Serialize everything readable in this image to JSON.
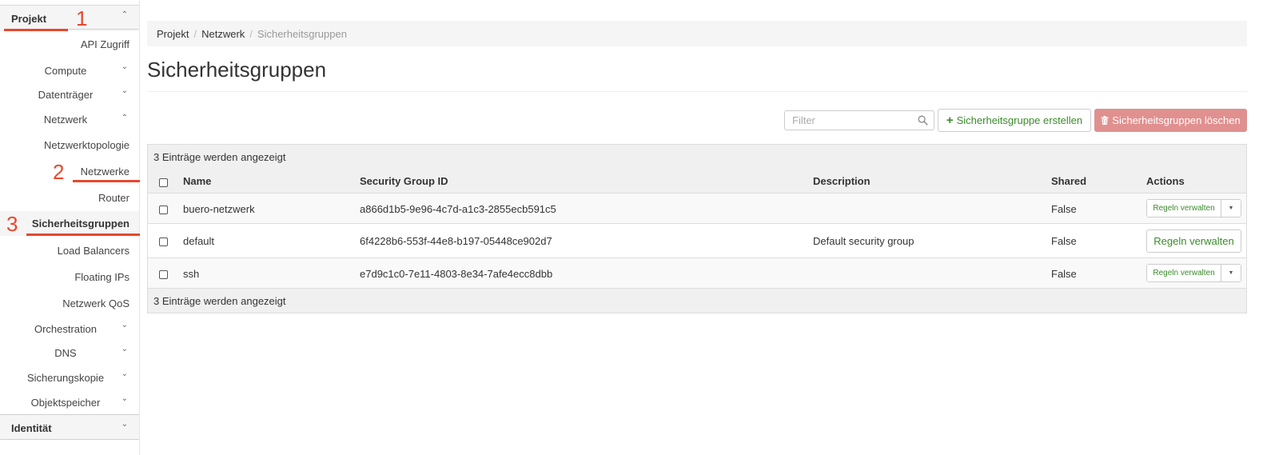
{
  "sidebar": {
    "project": {
      "label": "Projekt",
      "chevron": "chevron-up-icon"
    },
    "items": [
      {
        "label": "API Zugriff"
      },
      {
        "label": "Compute",
        "chevron": "chevron-down-icon"
      },
      {
        "label": "Datenträger",
        "chevron": "chevron-down-icon"
      },
      {
        "label": "Netzwerk",
        "chevron": "chevron-up-icon"
      },
      {
        "label": "Netzwerktopologie"
      },
      {
        "label": "Netzwerke"
      },
      {
        "label": "Router"
      },
      {
        "label": "Sicherheitsgruppen",
        "active": true
      },
      {
        "label": "Load Balancers"
      },
      {
        "label": "Floating IPs"
      },
      {
        "label": "Netzwerk QoS"
      },
      {
        "label": "Orchestration",
        "chevron": "chevron-down-icon"
      },
      {
        "label": "DNS",
        "chevron": "chevron-down-icon"
      },
      {
        "label": "Sicherungskopie",
        "chevron": "chevron-down-icon"
      },
      {
        "label": "Objektspeicher",
        "chevron": "chevron-down-icon"
      }
    ],
    "identity": {
      "label": "Identität",
      "chevron": "chevron-down-icon"
    }
  },
  "annotations": {
    "marker1": "1",
    "marker2": "2",
    "marker3": "3",
    "color": "#e8482d"
  },
  "breadcrumb": {
    "items": [
      "Projekt",
      "Netzwerk",
      "Sicherheitsgruppen"
    ],
    "separator": "/"
  },
  "page": {
    "title": "Sicherheitsgruppen"
  },
  "toolbar": {
    "filter_placeholder": "Filter",
    "create_label": "Sicherheitsgruppe erstellen",
    "delete_label": "Sicherheitsgruppen löschen"
  },
  "table": {
    "count_text_top": "3 Einträge werden angezeigt",
    "count_text_bottom": "3 Einträge werden angezeigt",
    "columns": [
      "Name",
      "Security Group ID",
      "Description",
      "Shared",
      "Actions"
    ],
    "rows": [
      {
        "name": "buero-netzwerk",
        "id": "a866d1b5-9e96-4c7d-a1c3-2855ecb591c5",
        "description": "",
        "shared": "False",
        "action": "Regeln verwalten"
      },
      {
        "name": "default",
        "id": "6f4228b6-553f-44e8-b197-05448ce902d7",
        "description": "Default security group",
        "shared": "False",
        "action": "Regeln verwalten"
      },
      {
        "name": "ssh",
        "id": "e7d9c1c0-7e11-4803-8e34-7afe4ecc8dbb",
        "description": "",
        "shared": "False",
        "action": "Regeln verwalten"
      }
    ]
  },
  "colors": {
    "accent_green": "#3b8b2b",
    "danger": "#e0908f",
    "marker_red": "#e8482d"
  }
}
